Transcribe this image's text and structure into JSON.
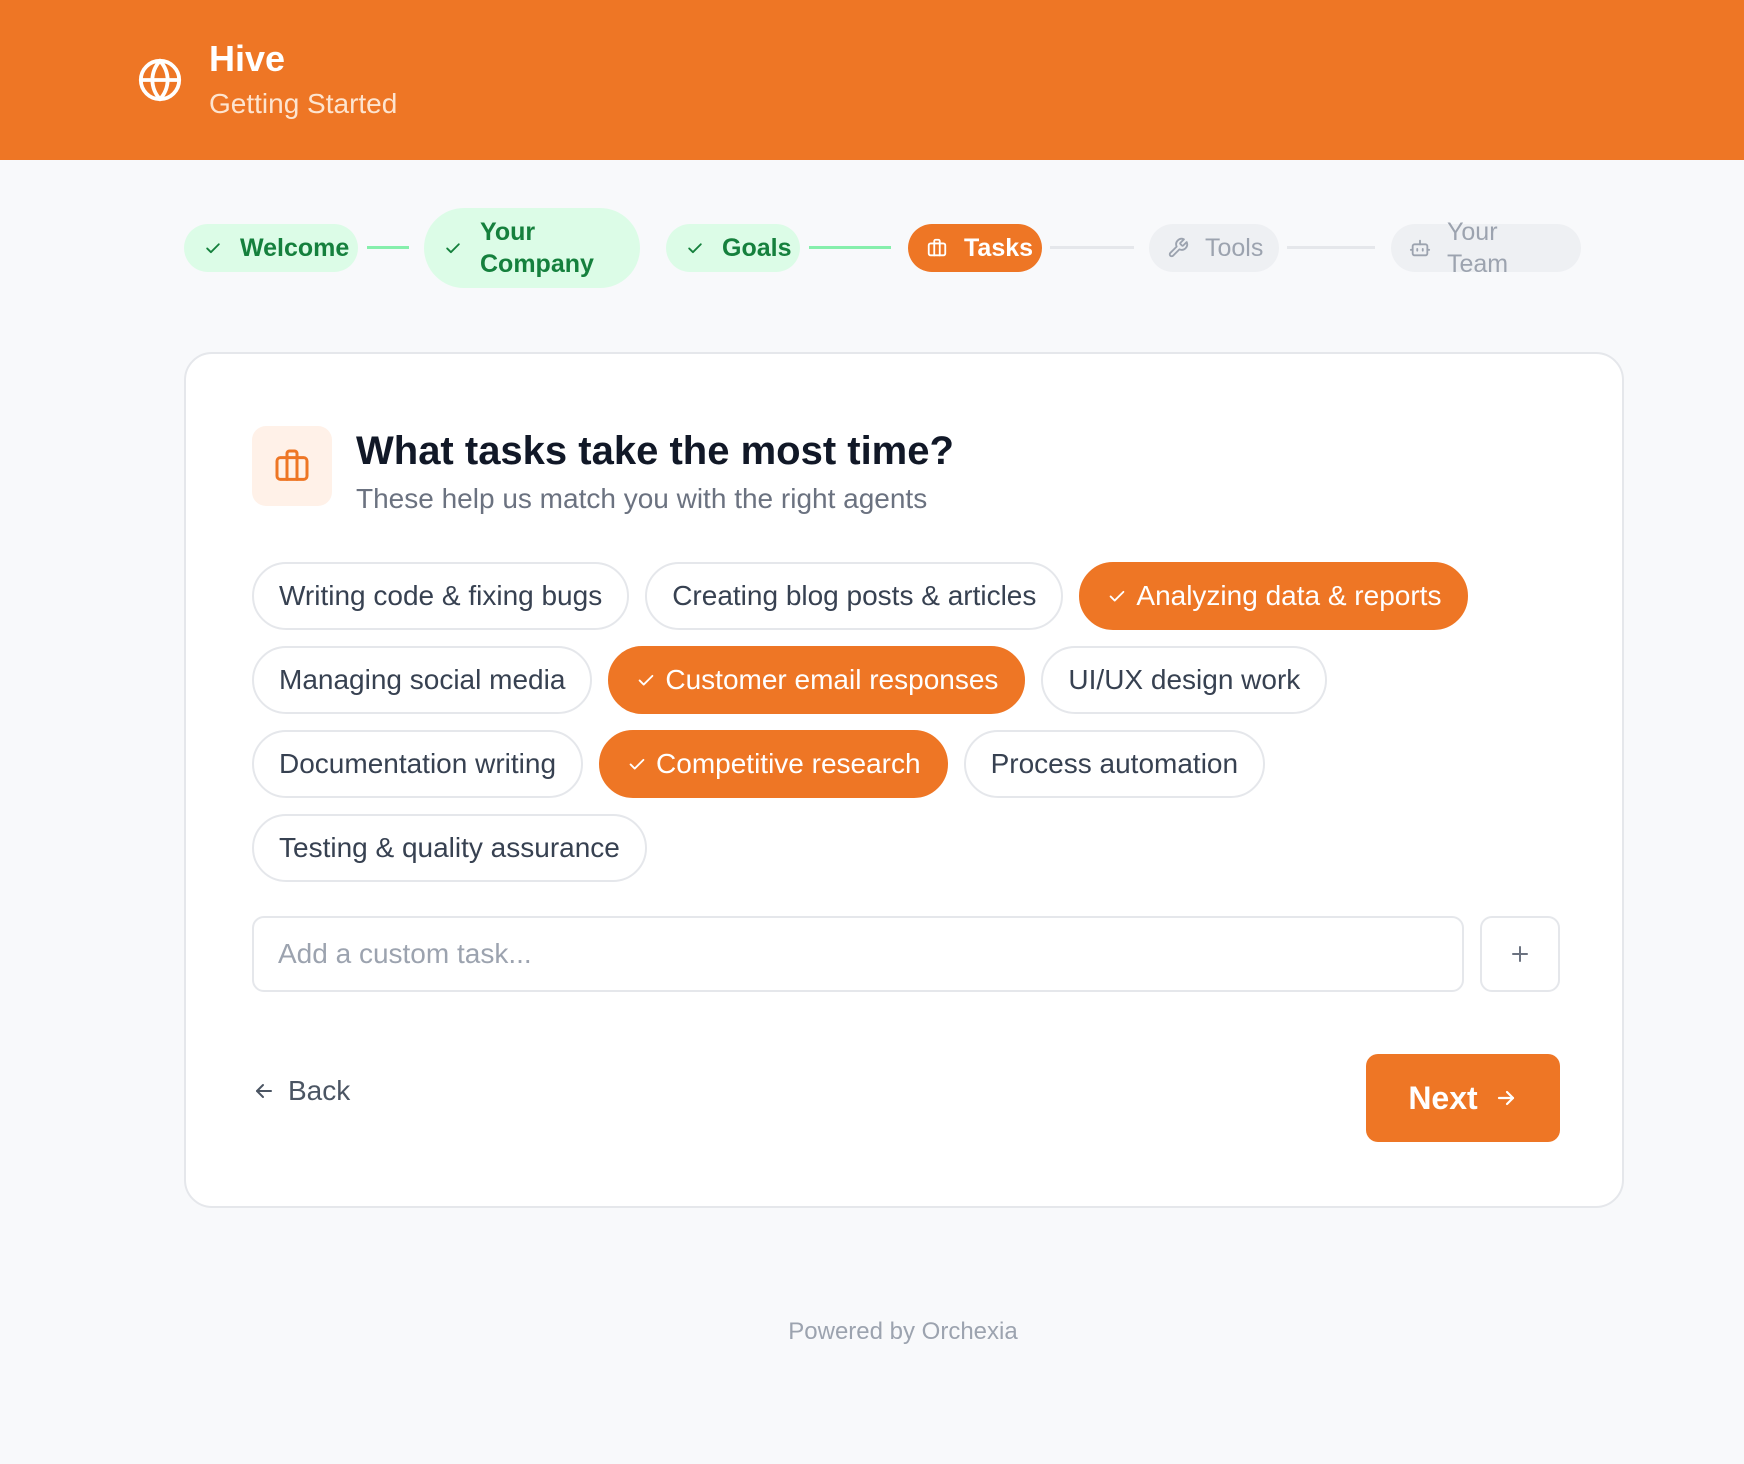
{
  "header": {
    "app_name": "Hive",
    "subtitle": "Getting Started",
    "icon": "globe-icon",
    "background": "#ee7625"
  },
  "stepper": {
    "steps": [
      {
        "label": "Welcome",
        "status": "done",
        "icon": "check-icon"
      },
      {
        "label": "Your Company",
        "status": "done",
        "icon": "check-icon"
      },
      {
        "label": "Goals",
        "status": "done",
        "icon": "check-icon"
      },
      {
        "label": "Tasks",
        "status": "active",
        "icon": "briefcase-icon"
      },
      {
        "label": "Tools",
        "status": "todo",
        "icon": "wrench-icon"
      },
      {
        "label": "Your Team",
        "status": "todo",
        "icon": "robot-icon"
      }
    ]
  },
  "card": {
    "icon": "briefcase-icon",
    "title": "What tasks take the most time?",
    "subtitle": "These help us match you with the right agents",
    "tasks": [
      {
        "label": "Writing code & fixing bugs",
        "selected": false
      },
      {
        "label": "Creating blog posts & articles",
        "selected": false
      },
      {
        "label": "Analyzing data & reports",
        "selected": true
      },
      {
        "label": "Managing social media",
        "selected": false
      },
      {
        "label": "Customer email responses",
        "selected": true
      },
      {
        "label": "UI/UX design work",
        "selected": false
      },
      {
        "label": "Documentation writing",
        "selected": false
      },
      {
        "label": "Competitive research",
        "selected": true
      },
      {
        "label": "Process automation",
        "selected": false
      },
      {
        "label": "Testing & quality assurance",
        "selected": false
      }
    ],
    "custom_input": {
      "value": "",
      "placeholder": "Add a custom task..."
    },
    "add_button_icon": "plus-icon",
    "back_label": "Back",
    "next_label": "Next"
  },
  "footer": {
    "text": "Powered by Orchexia"
  },
  "colors": {
    "accent": "#ee7625",
    "done_bg": "#dcfce7",
    "done_text": "#15803d",
    "todo_bg": "#eef0f3",
    "todo_text": "#9ca3af"
  }
}
